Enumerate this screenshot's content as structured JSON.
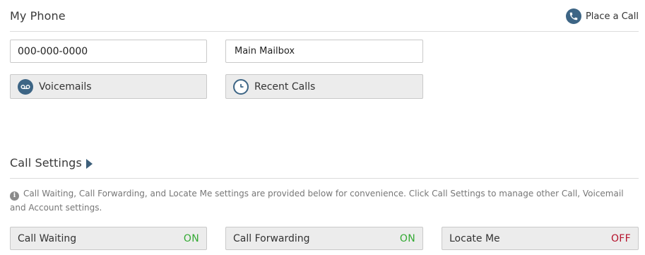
{
  "my_phone": {
    "title": "My Phone",
    "place_call_label": "Place a Call",
    "phone_number": "000-000-0000",
    "mailbox": "Main Mailbox",
    "voicemails_label": "Voicemails",
    "recent_calls_label": "Recent Calls"
  },
  "call_settings": {
    "title": "Call Settings",
    "info_text": "Call Waiting, Call Forwarding, and Locate Me settings are provided below for convenience. Click Call Settings to manage other Call, Voicemail and Account settings.",
    "toggles": [
      {
        "label": "Call Waiting",
        "state": "ON",
        "color": "#33aa33"
      },
      {
        "label": "Call Forwarding",
        "state": "ON",
        "color": "#33aa33"
      },
      {
        "label": "Locate Me",
        "state": "OFF",
        "color": "#b5122b"
      }
    ]
  },
  "icons": {
    "place_call": "phone-icon",
    "voicemails": "voicemail-icon",
    "recent_calls": "clock-icon",
    "call_settings": "triangle-right-icon",
    "info": "info-icon"
  },
  "colors": {
    "accent": "#3d6585",
    "on": "#33aa33",
    "off": "#b5122b"
  }
}
